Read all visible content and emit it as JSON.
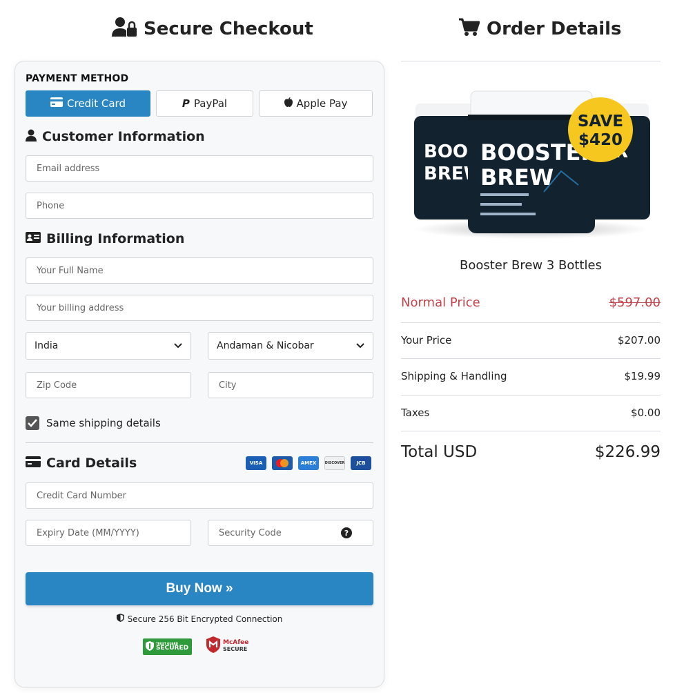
{
  "checkout_title": "Secure Checkout",
  "order_title": "Order Details",
  "payment": {
    "label": "PAYMENT METHOD",
    "methods": [
      "Credit Card",
      "PayPal",
      "Apple Pay"
    ]
  },
  "customer": {
    "heading": "Customer Information",
    "email_placeholder": "Email address",
    "phone_placeholder": "Phone"
  },
  "billing": {
    "heading": "Billing Information",
    "name_placeholder": "Your Full Name",
    "address_placeholder": "Your billing address",
    "country": "India",
    "state": "Andaman & Nicobar",
    "zip_placeholder": "Zip Code",
    "city_placeholder": "City",
    "same_shipping": "Same shipping details"
  },
  "card": {
    "heading": "Card Details",
    "logos": [
      "VISA",
      "MC",
      "AMEX",
      "DISCOVER",
      "JCB"
    ],
    "number_placeholder": "Credit Card Number",
    "expiry_placeholder": "Expiry Date (MM/YYYY)",
    "cvc_placeholder": "Security Code"
  },
  "buy_label": "Buy Now »",
  "secure_text": "Secure 256 Bit Encrypted Connection",
  "badges": {
    "trustguard_top": "TRUST GUARD",
    "trustguard_main": "SECURED",
    "mcafee_top": "McAfee",
    "mcafee_bottom": "SECURE"
  },
  "product": {
    "name": "Booster Brew 3 Bottles",
    "label_line1": "BOOSTER",
    "label_line2": "BREW",
    "save_line1": "SAVE",
    "save_line2": "$420"
  },
  "prices": {
    "normal_label": "Normal Price",
    "normal_value": "$597.00",
    "your_label": "Your Price",
    "your_value": "$207.00",
    "shipping_label": "Shipping & Handling",
    "shipping_value": "$19.99",
    "taxes_label": "Taxes",
    "taxes_value": "$0.00",
    "total_label": "Total USD",
    "total_value": "$226.99"
  },
  "colors": {
    "accent": "#2a86c2",
    "normal_price": "#c2424a",
    "save_badge": "#f6c81f",
    "jar": "#13222f"
  }
}
